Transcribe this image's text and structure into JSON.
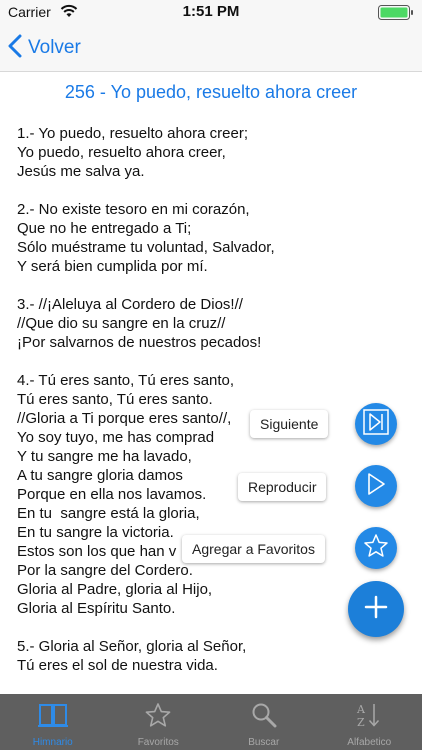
{
  "status_bar": {
    "carrier": "Carrier",
    "time": "1:51 PM"
  },
  "nav": {
    "back_label": "Volver"
  },
  "song": {
    "title": "256 - Yo puedo, resuelto ahora creer",
    "verses": [
      [
        "1.- Yo puedo, resuelto ahora creer;",
        "Yo puedo, resuelto ahora creer,",
        "Jesús me salva ya."
      ],
      [
        "2.- No existe tesoro en mi corazón,",
        "Que no he entregado a Ti;",
        "Sólo muéstrame tu voluntad, Salvador,",
        "Y será bien cumplida por mí."
      ],
      [
        "3.- //¡Aleluya al Cordero de Dios!//",
        "//Que dio su sangre en la cruz//",
        "¡Por salvarnos de nuestros pecados!"
      ],
      [
        "4.- Tú eres santo, Tú eres santo,",
        "Tú eres santo, Tú eres santo.",
        "//Gloria a Ti porque eres santo//,",
        "Yo soy tuyo, me has comprad",
        "Y tu sangre me ha lavado,",
        "A tu sangre gloria damos",
        "Porque en ella nos lavamos.",
        "En tu  sangre está la gloria,",
        "En tu sangre la victoria.",
        "Estos son los que han v",
        "Por la sangre del Cordero.",
        "Gloria al Padre, gloria al Hijo,",
        "Gloria al Espíritu Santo."
      ],
      [
        "5.- Gloria al Señor, gloria al Señor,",
        "Tú eres el sol de nuestra vida."
      ]
    ]
  },
  "actions": {
    "next_label": "Siguiente",
    "play_label": "Reproducir",
    "favorite_label": "Agregar a Favoritos"
  },
  "colors": {
    "accent": "#1a7ae6",
    "fab": "#2389e6",
    "tab_bar": "#5f5f5f",
    "tab_active": "#2e8be8"
  },
  "tabs": [
    {
      "label": "Himnario",
      "icon": "book-icon",
      "active": true
    },
    {
      "label": "Favoritos",
      "icon": "star-icon",
      "active": false
    },
    {
      "label": "Buscar",
      "icon": "search-icon",
      "active": false
    },
    {
      "label": "Alfabetico",
      "icon": "sort-az-icon",
      "active": false
    }
  ]
}
